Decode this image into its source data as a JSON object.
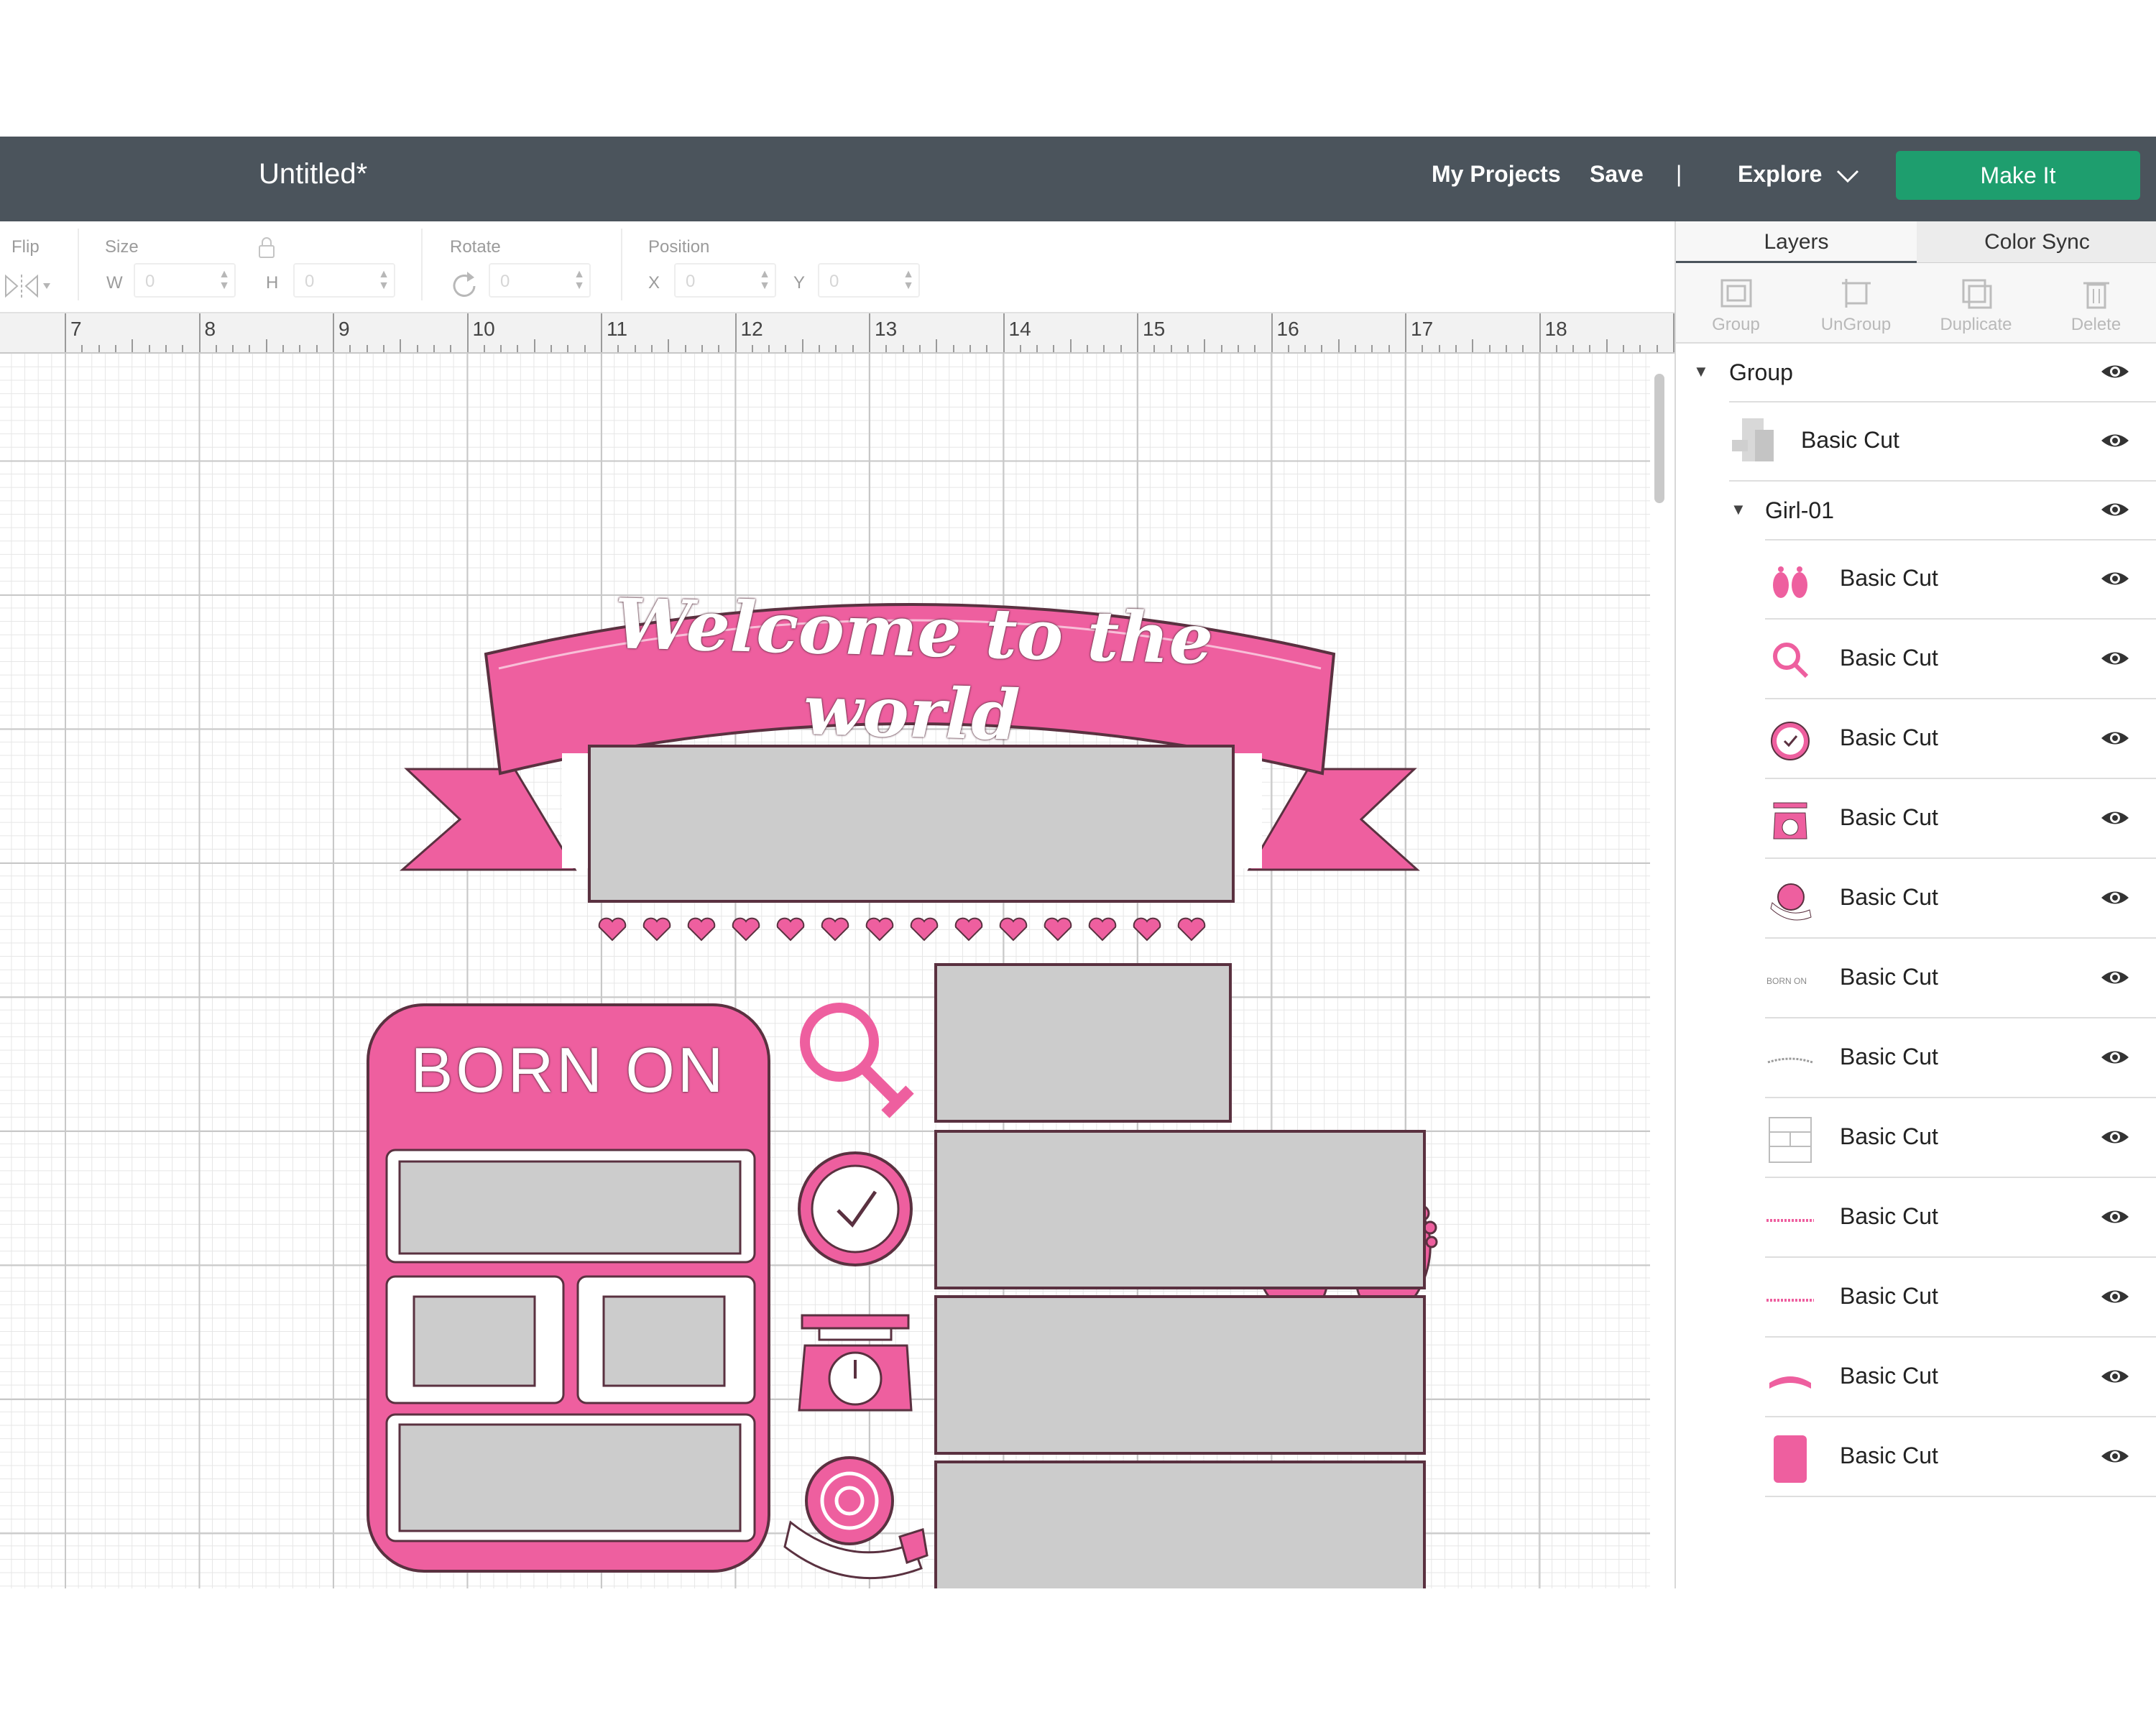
{
  "header": {
    "title": "Untitled*",
    "my_projects": "My Projects",
    "save": "Save",
    "separator": "|",
    "explore": "Explore",
    "make_it": "Make It"
  },
  "toolbar": {
    "flip": "Flip",
    "size": "Size",
    "w": "W",
    "h": "H",
    "w_value": "0",
    "h_value": "0",
    "rotate": "Rotate",
    "rotate_value": "0",
    "position": "Position",
    "x": "X",
    "y": "Y",
    "x_value": "0",
    "y_value": "0"
  },
  "ruler": {
    "labels": [
      "7",
      "8",
      "9",
      "10",
      "11",
      "12",
      "13",
      "14",
      "15",
      "16",
      "17",
      "18"
    ]
  },
  "design": {
    "banner_text": "Welcome to the world",
    "born_on": "BORN ON"
  },
  "panel": {
    "tabs": [
      "Layers",
      "Color Sync"
    ],
    "actions": [
      "Group",
      "UnGroup",
      "Duplicate",
      "Delete"
    ],
    "group": {
      "label": "Group",
      "basic_cut": "Basic Cut"
    },
    "subgroup": {
      "label": "Girl-01"
    },
    "items": [
      {
        "label": "Basic Cut",
        "icon": "baby-feet-icon"
      },
      {
        "label": "Basic Cut",
        "icon": "female-symbol-icon"
      },
      {
        "label": "Basic Cut",
        "icon": "clock-icon"
      },
      {
        "label": "Basic Cut",
        "icon": "scale-icon"
      },
      {
        "label": "Basic Cut",
        "icon": "tape-measure-icon"
      },
      {
        "label": "Basic Cut",
        "icon": "born-on-text-icon"
      },
      {
        "label": "Basic Cut",
        "icon": "welcome-text-icon"
      },
      {
        "label": "Basic Cut",
        "icon": "frames-icon"
      },
      {
        "label": "Basic Cut",
        "icon": "hearts-row-icon"
      },
      {
        "label": "Basic Cut",
        "icon": "hearts-row-icon"
      },
      {
        "label": "Basic Cut",
        "icon": "banner-icon"
      },
      {
        "label": "Basic Cut",
        "icon": "pink-card-icon"
      }
    ]
  },
  "colors": {
    "header_bg": "#4b545c",
    "make_it": "#1e9e6e",
    "pink": "#ee5f9f",
    "dark_outline": "#5a3140",
    "frame_gray": "#cccccc"
  }
}
